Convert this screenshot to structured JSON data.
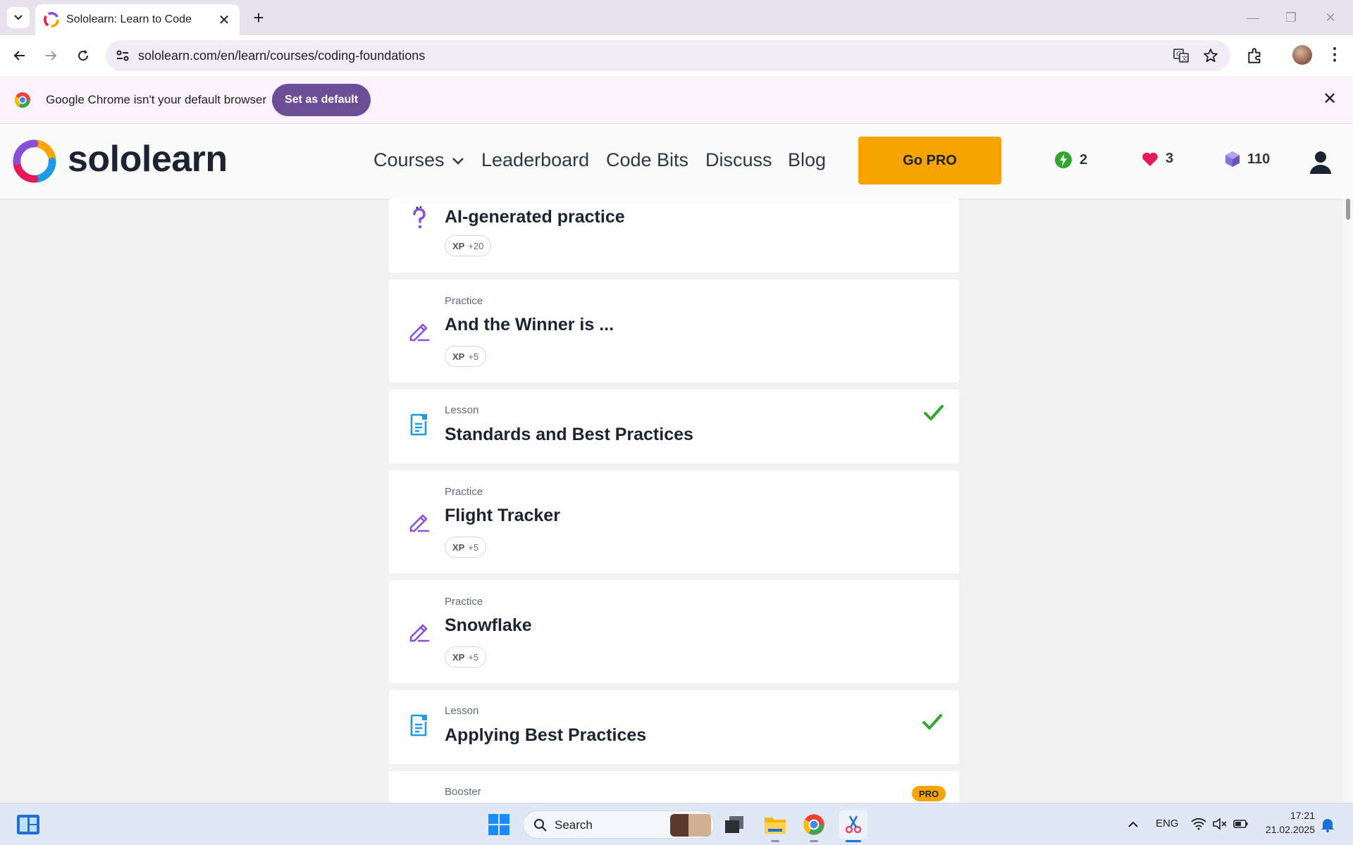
{
  "browser": {
    "tab_title": "Sololearn: Learn to Code",
    "url": "sololearn.com/en/learn/courses/coding-foundations",
    "infobar_message": "Google Chrome isn't your default browser",
    "infobar_button": "Set as default"
  },
  "header": {
    "logo_text": "sololearn",
    "nav": {
      "courses": "Courses",
      "leaderboard": "Leaderboard",
      "code_bits": "Code Bits",
      "discuss": "Discuss",
      "blog": "Blog"
    },
    "go_pro": "Go PRO",
    "streak": "2",
    "hearts": "3",
    "gems": "110"
  },
  "lessons": [
    {
      "kind": "",
      "title": "AI-generated practice",
      "xp_label": "XP",
      "xp_value": "+20",
      "icon": "question-icon",
      "completed": false
    },
    {
      "kind": "Practice",
      "title": "And the Winner is ...",
      "xp_label": "XP",
      "xp_value": "+5",
      "icon": "pencil-icon",
      "completed": false
    },
    {
      "kind": "Lesson",
      "title": "Standards and Best Practices",
      "icon": "document-icon",
      "completed": true
    },
    {
      "kind": "Practice",
      "title": "Flight Tracker",
      "xp_label": "XP",
      "xp_value": "+5",
      "icon": "pencil-icon",
      "completed": false
    },
    {
      "kind": "Practice",
      "title": "Snowflake",
      "xp_label": "XP",
      "xp_value": "+5",
      "icon": "pencil-icon",
      "completed": false
    },
    {
      "kind": "Lesson",
      "title": "Applying Best Practices",
      "icon": "document-icon",
      "completed": true
    },
    {
      "kind": "Booster",
      "badge": "PRO",
      "title": "",
      "completed": false
    }
  ],
  "taskbar": {
    "search_label": "Search",
    "language": "ENG",
    "time": "17:21",
    "date": "21.02.2025"
  },
  "colors": {
    "brand_orange": "#f7a400",
    "purple_icon": "#8a4fd8",
    "blue_icon": "#1e9be8",
    "check_green": "#2fa82f",
    "infobar_button": "#6c4e96"
  }
}
